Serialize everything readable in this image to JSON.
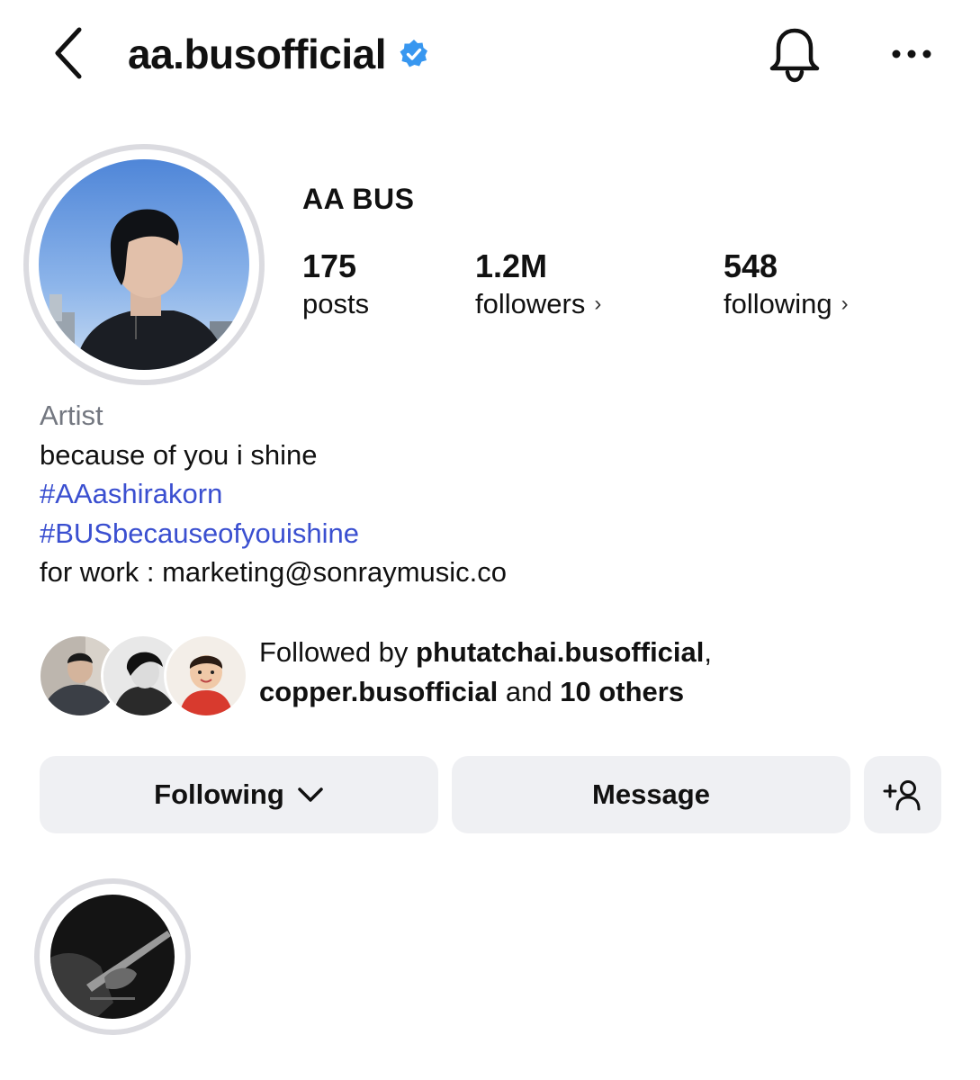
{
  "header": {
    "username": "aa.busofficial",
    "icons": {
      "back": "chevron-left-icon",
      "verified": "verified-badge-icon",
      "notifications": "bell-icon",
      "more": "more-horizontal-icon"
    }
  },
  "profile": {
    "display_name": "AA BUS",
    "stats": {
      "posts": {
        "value": "175",
        "label": "posts"
      },
      "followers": {
        "value": "1.2M",
        "label": "followers"
      },
      "following": {
        "value": "548",
        "label": "following"
      }
    },
    "stats_chevron": "›"
  },
  "bio": {
    "category": "Artist",
    "line1": "because of you i shine",
    "hashtag1": "#AAashirakorn",
    "hashtag2": "#BUSbecauseofyouishine",
    "contact": "for work : marketing@sonraymusic.co"
  },
  "followed_by": {
    "prefix": "Followed by ",
    "user1": "phutatchai.busofficial",
    "comma": ",",
    "user2": "copper.busofficial",
    "middle": " and ",
    "others": "10 others"
  },
  "actions": {
    "following_label": "Following",
    "message_label": "Message",
    "add_person_icon": "add-person-icon"
  },
  "colors": {
    "accent_link": "#3a4fd0",
    "verified_blue": "#3897f0",
    "button_bg": "#eff0f3",
    "secondary_text": "#737780"
  }
}
